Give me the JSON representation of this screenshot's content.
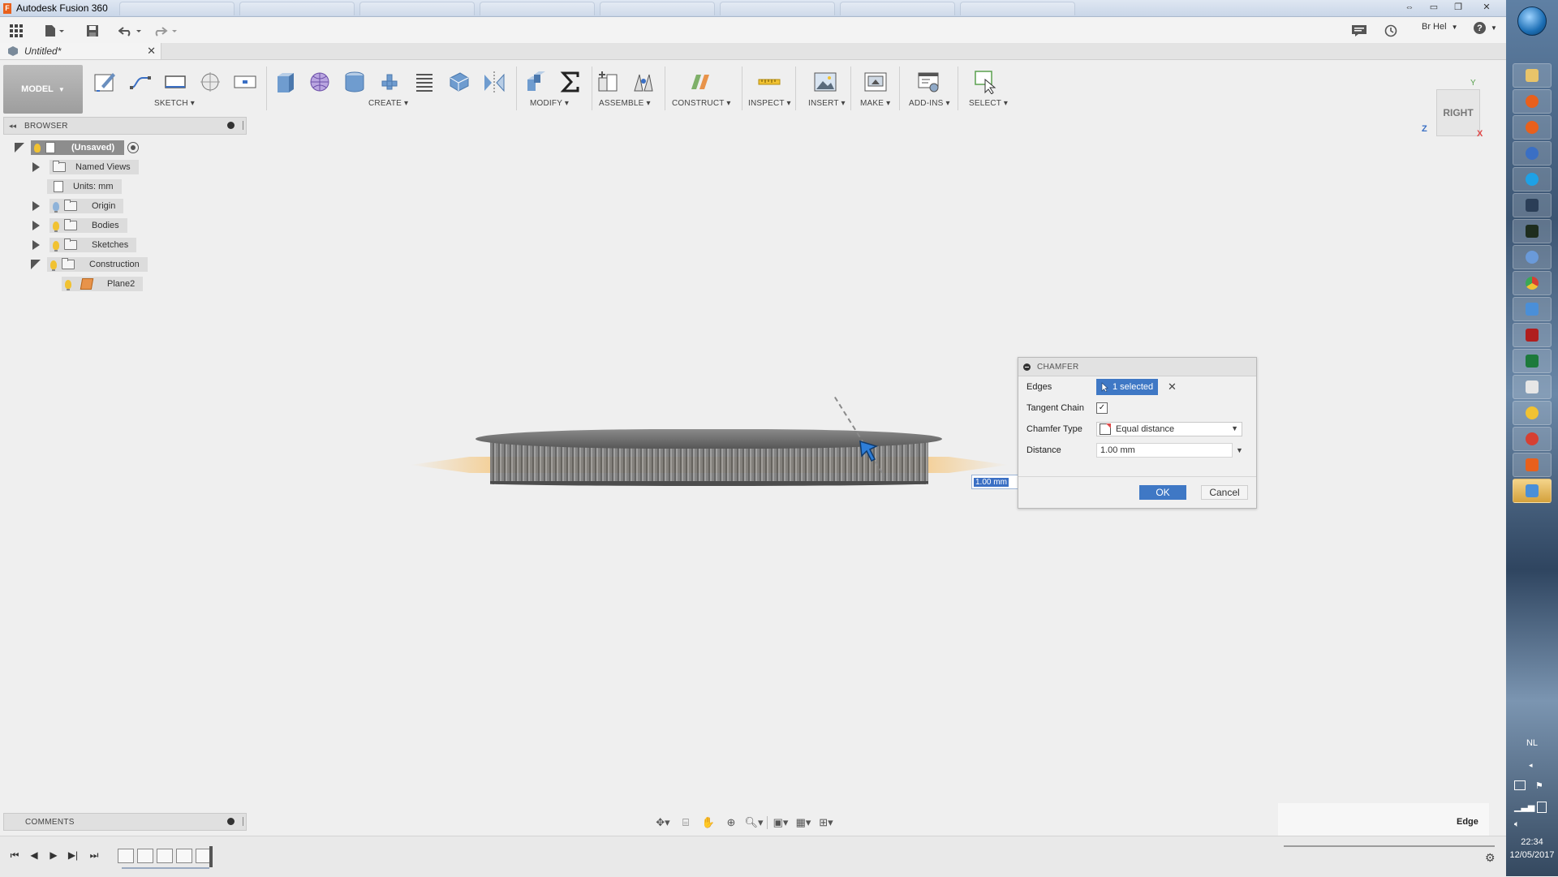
{
  "window": {
    "app_title": "Autodesk Fusion 360",
    "logo_letter": "F"
  },
  "quickbar": {
    "user": "Br Hel",
    "help": "?"
  },
  "doc_tab": {
    "name": "Untitled*"
  },
  "toolbar": {
    "workspace": "MODEL",
    "groups": {
      "sketch": "SKETCH",
      "create": "CREATE",
      "modify": "MODIFY",
      "assemble": "ASSEMBLE",
      "construct": "CONSTRUCT",
      "inspect": "INSPECT",
      "insert": "INSERT",
      "make": "MAKE",
      "addins": "ADD-INS",
      "select": "SELECT"
    }
  },
  "browser": {
    "title": "BROWSER",
    "root": "(Unsaved)",
    "items": [
      {
        "label": "Named Views"
      },
      {
        "label": "Units: mm"
      },
      {
        "label": "Origin"
      },
      {
        "label": "Bodies"
      },
      {
        "label": "Sketches"
      },
      {
        "label": "Construction"
      },
      {
        "label": "Plane2"
      }
    ]
  },
  "viewcube": {
    "face": "RIGHT",
    "axis_y": "Y",
    "axis_z": "Z",
    "axis_x": "X"
  },
  "canvas_input": {
    "value": "1.00 mm"
  },
  "chamfer": {
    "title": "CHAMFER",
    "edges_label": "Edges",
    "edges_value": "1 selected",
    "tangent_label": "Tangent Chain",
    "tangent_checked": true,
    "type_label": "Chamfer Type",
    "type_value": "Equal distance",
    "distance_label": "Distance",
    "distance_value": "1.00 mm",
    "ok": "OK",
    "cancel": "Cancel"
  },
  "comments": {
    "title": "COMMENTS"
  },
  "status": {
    "selection_type": "Edge"
  },
  "taskbar": {
    "lang": "NL",
    "time": "22:34",
    "date": "12/05/2017"
  },
  "colors": {
    "accent": "#3f78c5",
    "construction_plane": "#f5c882",
    "body": "#6b6b6b"
  }
}
